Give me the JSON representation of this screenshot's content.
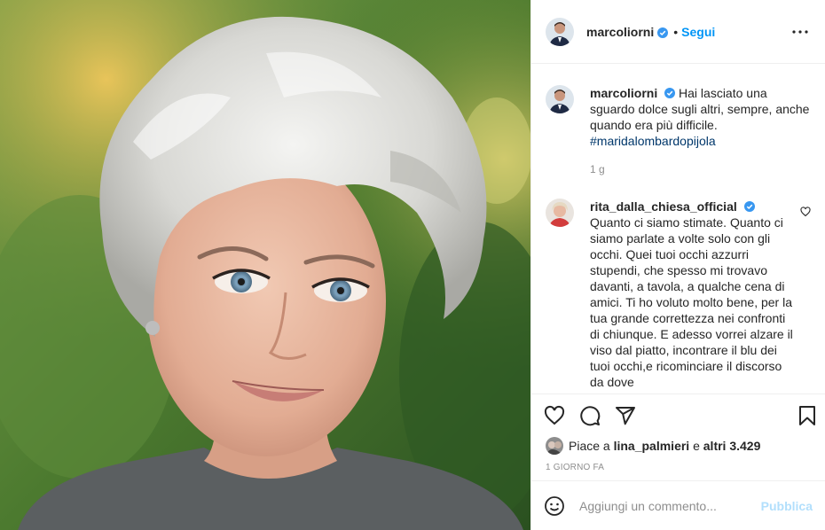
{
  "post": {
    "author": "marcoliorni",
    "separator": "•",
    "follow_label": "Segui",
    "caption_prefix": "Hai lasciato una sguardo dolce sugli altri, sempre, anche quando era più difficile.",
    "caption_hashtag": "#maridalombardopijola",
    "caption_age": "1 g"
  },
  "comments": [
    {
      "author": "rita_dalla_chiesa_official",
      "text": "Quanto ci siamo stimate. Quanto ci siamo parlate a volte solo con gli occhi. Quei tuoi occhi azzurri stupendi, che spesso mi trovavo davanti, a tavola, a qualche cena di amici. Ti ho voluto molto bene, per la tua grande correttezza nei confronti di chiunque. E adesso vorrei alzare il viso dal piatto, incontrare il blu dei tuoi occhi,e ricominciare il discorso da dove"
    }
  ],
  "likes": {
    "prefix": "Piace a ",
    "user": "lina_palmieri",
    "middle": " e ",
    "others": "altri 3.429"
  },
  "timestamp": "1 GIORNO FA",
  "add_comment": {
    "placeholder": "Aggiungi un commento...",
    "publish_label": "Pubblica"
  },
  "icons": {
    "more": "more-options-icon",
    "like": "heart-icon",
    "comment": "comment-icon",
    "share": "paper-plane-icon",
    "save": "bookmark-icon",
    "emoji": "smiley-icon",
    "verified": "verified-badge-icon"
  },
  "colors": {
    "link_blue": "#0095f6",
    "verified_blue": "#3897f0",
    "publish_disabled": "#b2dffc",
    "muted": "#8e8e8e",
    "hashtag": "#00376b"
  }
}
